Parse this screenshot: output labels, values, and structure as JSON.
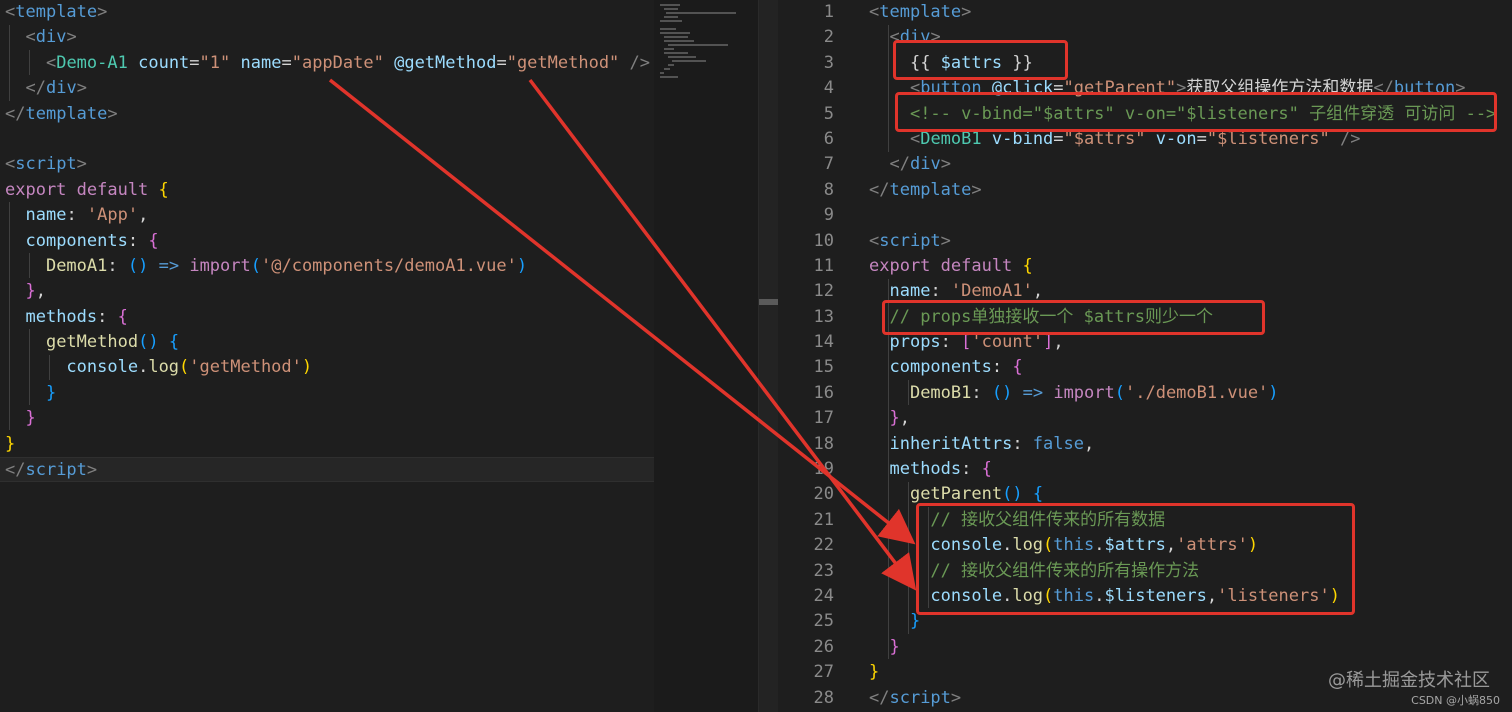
{
  "left_editor": {
    "lines": [
      [
        [
          "br",
          "<"
        ],
        [
          "tag",
          "template"
        ],
        [
          "br",
          ">"
        ]
      ],
      [
        [
          "plain",
          "  "
        ],
        [
          "br",
          "<"
        ],
        [
          "tag",
          "div"
        ],
        [
          "br",
          ">"
        ]
      ],
      [
        [
          "plain",
          "    "
        ],
        [
          "br",
          "<"
        ],
        [
          "cmp",
          "Demo-A1"
        ],
        [
          "plain",
          " "
        ],
        [
          "attr",
          "count"
        ],
        [
          "plain",
          "="
        ],
        [
          "str",
          "\"1\""
        ],
        [
          "plain",
          " "
        ],
        [
          "attr",
          "name"
        ],
        [
          "plain",
          "="
        ],
        [
          "str",
          "\"appDate\""
        ],
        [
          "plain",
          " "
        ],
        [
          "attr",
          "@getMethod"
        ],
        [
          "plain",
          "="
        ],
        [
          "str",
          "\"getMethod\""
        ],
        [
          "plain",
          " "
        ],
        [
          "br",
          "/>"
        ]
      ],
      [
        [
          "plain",
          "  "
        ],
        [
          "br",
          "</"
        ],
        [
          "tag",
          "div"
        ],
        [
          "br",
          ">"
        ]
      ],
      [
        [
          "br",
          "</"
        ],
        [
          "tag",
          "template"
        ],
        [
          "br",
          ">"
        ]
      ],
      [
        [
          "plain",
          ""
        ]
      ],
      [
        [
          "br",
          "<"
        ],
        [
          "tag",
          "script"
        ],
        [
          "br",
          ">"
        ]
      ],
      [
        [
          "kw",
          "export default"
        ],
        [
          "plain",
          " "
        ],
        [
          "brace1",
          "{"
        ]
      ],
      [
        [
          "plain",
          "  "
        ],
        [
          "vname",
          "name"
        ],
        [
          "plain",
          ": "
        ],
        [
          "str",
          "'App'"
        ],
        [
          "plain",
          ","
        ]
      ],
      [
        [
          "plain",
          "  "
        ],
        [
          "vname",
          "components"
        ],
        [
          "plain",
          ": "
        ],
        [
          "brace2",
          "{"
        ]
      ],
      [
        [
          "plain",
          "    "
        ],
        [
          "fn",
          "DemoA1"
        ],
        [
          "plain",
          ": "
        ],
        [
          "brace3",
          "()"
        ],
        [
          "plain",
          " "
        ],
        [
          "bool",
          "=>"
        ],
        [
          "plain",
          " "
        ],
        [
          "kw",
          "import"
        ],
        [
          "brace3",
          "("
        ],
        [
          "str",
          "'@/components/demoA1.vue'"
        ],
        [
          "brace3",
          ")"
        ]
      ],
      [
        [
          "plain",
          "  "
        ],
        [
          "brace2",
          "}"
        ],
        [
          "plain",
          ","
        ]
      ],
      [
        [
          "plain",
          "  "
        ],
        [
          "vname",
          "methods"
        ],
        [
          "plain",
          ": "
        ],
        [
          "brace2",
          "{"
        ]
      ],
      [
        [
          "plain",
          "    "
        ],
        [
          "fn",
          "getMethod"
        ],
        [
          "brace3",
          "()"
        ],
        [
          "plain",
          " "
        ],
        [
          "brace3",
          "{"
        ]
      ],
      [
        [
          "plain",
          "      "
        ],
        [
          "vname",
          "console"
        ],
        [
          "plain",
          "."
        ],
        [
          "fn",
          "log"
        ],
        [
          "brace1",
          "("
        ],
        [
          "str",
          "'getMethod'"
        ],
        [
          "brace1",
          ")"
        ]
      ],
      [
        [
          "plain",
          "    "
        ],
        [
          "brace3",
          "}"
        ]
      ],
      [
        [
          "plain",
          "  "
        ],
        [
          "brace2",
          "}"
        ]
      ],
      [
        [
          "brace1",
          "}"
        ]
      ],
      [
        [
          "br",
          "</"
        ],
        [
          "tag",
          "script"
        ],
        [
          "br",
          ">"
        ]
      ]
    ]
  },
  "right_editor": {
    "lines": [
      {
        "n": "1",
        "t": [
          [
            "br",
            "<"
          ],
          [
            "tag",
            "template"
          ],
          [
            "br",
            ">"
          ]
        ]
      },
      {
        "n": "2",
        "t": [
          [
            "plain",
            "  "
          ],
          [
            "br",
            "<"
          ],
          [
            "tag",
            "div"
          ],
          [
            "br",
            ">"
          ]
        ]
      },
      {
        "n": "3",
        "t": [
          [
            "plain",
            "    "
          ],
          [
            "plain",
            "{{ "
          ],
          [
            "vname",
            "$attrs"
          ],
          [
            "plain",
            " }}"
          ]
        ]
      },
      {
        "n": "4",
        "t": [
          [
            "plain",
            "    "
          ],
          [
            "br",
            "<"
          ],
          [
            "tag",
            "button"
          ],
          [
            "plain",
            " "
          ],
          [
            "attr",
            "@click"
          ],
          [
            "plain",
            "="
          ],
          [
            "str",
            "\"getParent\""
          ],
          [
            "br",
            ">"
          ],
          [
            "plain",
            "获取父组操作方法和数据"
          ],
          [
            "br",
            "</"
          ],
          [
            "tag",
            "button"
          ],
          [
            "br",
            ">"
          ]
        ]
      },
      {
        "n": "5",
        "t": [
          [
            "plain",
            "    "
          ],
          [
            "cm",
            "<!-- v-bind=\"$attrs\" v-on=\"$listeners\" 子组件穿透 可访问 -->"
          ]
        ]
      },
      {
        "n": "6",
        "t": [
          [
            "plain",
            "    "
          ],
          [
            "br",
            "<"
          ],
          [
            "cmp",
            "DemoB1"
          ],
          [
            "plain",
            " "
          ],
          [
            "attr",
            "v-bind"
          ],
          [
            "plain",
            "="
          ],
          [
            "str",
            "\"$attrs\""
          ],
          [
            "plain",
            " "
          ],
          [
            "attr",
            "v-on"
          ],
          [
            "plain",
            "="
          ],
          [
            "str",
            "\"$listeners\""
          ],
          [
            "plain",
            " "
          ],
          [
            "br",
            "/>"
          ]
        ]
      },
      {
        "n": "7",
        "t": [
          [
            "plain",
            "  "
          ],
          [
            "br",
            "</"
          ],
          [
            "tag",
            "div"
          ],
          [
            "br",
            ">"
          ]
        ]
      },
      {
        "n": "8",
        "t": [
          [
            "br",
            "</"
          ],
          [
            "tag",
            "template"
          ],
          [
            "br",
            ">"
          ]
        ]
      },
      {
        "n": "9",
        "t": [
          [
            "plain",
            ""
          ]
        ]
      },
      {
        "n": "10",
        "t": [
          [
            "br",
            "<"
          ],
          [
            "tag",
            "script"
          ],
          [
            "br",
            ">"
          ]
        ]
      },
      {
        "n": "11",
        "t": [
          [
            "kw",
            "export default"
          ],
          [
            "plain",
            " "
          ],
          [
            "brace1",
            "{"
          ]
        ]
      },
      {
        "n": "12",
        "t": [
          [
            "plain",
            "  "
          ],
          [
            "vname",
            "name"
          ],
          [
            "plain",
            ": "
          ],
          [
            "str",
            "'DemoA1'"
          ],
          [
            "plain",
            ","
          ]
        ]
      },
      {
        "n": "13",
        "t": [
          [
            "plain",
            "  "
          ],
          [
            "cm",
            "// props单独接收一个 $attrs则少一个"
          ]
        ]
      },
      {
        "n": "14",
        "t": [
          [
            "plain",
            "  "
          ],
          [
            "vname",
            "props"
          ],
          [
            "plain",
            ": "
          ],
          [
            "brace2",
            "["
          ],
          [
            "str",
            "'count'"
          ],
          [
            "brace2",
            "]"
          ],
          [
            "plain",
            ","
          ]
        ]
      },
      {
        "n": "15",
        "t": [
          [
            "plain",
            "  "
          ],
          [
            "vname",
            "components"
          ],
          [
            "plain",
            ": "
          ],
          [
            "brace2",
            "{"
          ]
        ]
      },
      {
        "n": "16",
        "t": [
          [
            "plain",
            "    "
          ],
          [
            "fn",
            "DemoB1"
          ],
          [
            "plain",
            ": "
          ],
          [
            "brace3",
            "()"
          ],
          [
            "plain",
            " "
          ],
          [
            "bool",
            "=>"
          ],
          [
            "plain",
            " "
          ],
          [
            "kw",
            "import"
          ],
          [
            "brace3",
            "("
          ],
          [
            "str",
            "'./demoB1.vue'"
          ],
          [
            "brace3",
            ")"
          ]
        ]
      },
      {
        "n": "17",
        "t": [
          [
            "plain",
            "  "
          ],
          [
            "brace2",
            "}"
          ],
          [
            "plain",
            ","
          ]
        ]
      },
      {
        "n": "18",
        "t": [
          [
            "plain",
            "  "
          ],
          [
            "vname",
            "inheritAttrs"
          ],
          [
            "plain",
            ": "
          ],
          [
            "bool",
            "false"
          ],
          [
            "plain",
            ","
          ]
        ]
      },
      {
        "n": "19",
        "t": [
          [
            "plain",
            "  "
          ],
          [
            "vname",
            "methods"
          ],
          [
            "plain",
            ": "
          ],
          [
            "brace2",
            "{"
          ]
        ]
      },
      {
        "n": "20",
        "t": [
          [
            "plain",
            "    "
          ],
          [
            "fn",
            "getParent"
          ],
          [
            "brace3",
            "()"
          ],
          [
            "plain",
            " "
          ],
          [
            "brace3",
            "{"
          ]
        ]
      },
      {
        "n": "21",
        "t": [
          [
            "plain",
            "      "
          ],
          [
            "cm",
            "// 接收父组件传来的所有数据"
          ]
        ]
      },
      {
        "n": "22",
        "t": [
          [
            "plain",
            "      "
          ],
          [
            "vname",
            "console"
          ],
          [
            "plain",
            "."
          ],
          [
            "fn",
            "log"
          ],
          [
            "brace1",
            "("
          ],
          [
            "bool",
            "this"
          ],
          [
            "plain",
            "."
          ],
          [
            "vname",
            "$attrs"
          ],
          [
            "plain",
            ","
          ],
          [
            "str",
            "'attrs'"
          ],
          [
            "brace1",
            ")"
          ]
        ]
      },
      {
        "n": "23",
        "t": [
          [
            "plain",
            "      "
          ],
          [
            "cm",
            "// 接收父组件传来的所有操作方法"
          ]
        ]
      },
      {
        "n": "24",
        "t": [
          [
            "plain",
            "      "
          ],
          [
            "vname",
            "console"
          ],
          [
            "plain",
            "."
          ],
          [
            "fn",
            "log"
          ],
          [
            "brace1",
            "("
          ],
          [
            "bool",
            "this"
          ],
          [
            "plain",
            "."
          ],
          [
            "vname",
            "$listeners"
          ],
          [
            "plain",
            ","
          ],
          [
            "str",
            "'listeners'"
          ],
          [
            "brace1",
            ")"
          ]
        ]
      },
      {
        "n": "25",
        "t": [
          [
            "plain",
            "    "
          ],
          [
            "brace3",
            "}"
          ]
        ]
      },
      {
        "n": "26",
        "t": [
          [
            "plain",
            "  "
          ],
          [
            "brace2",
            "}"
          ]
        ]
      },
      {
        "n": "27",
        "t": [
          [
            "brace1",
            "}"
          ]
        ]
      },
      {
        "n": "28",
        "t": [
          [
            "br",
            "</"
          ],
          [
            "tag",
            "script"
          ],
          [
            "br",
            ">"
          ]
        ]
      }
    ]
  },
  "watermark": "@稀土掘金技术社区",
  "credit": "CSDN @小蜗850",
  "colors": {
    "editor_bg": "#1e1e1e",
    "highlight_box": "#e0342b",
    "arrow": "#e0342b"
  }
}
